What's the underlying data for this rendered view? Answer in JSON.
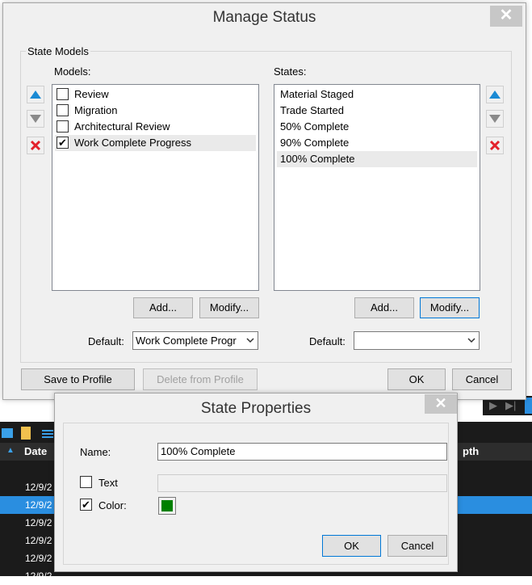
{
  "main_dialog": {
    "title": "Manage Status",
    "group_label": "State Models",
    "models_label": "Models:",
    "states_label": "States:",
    "models": [
      {
        "label": "Review",
        "checked": false
      },
      {
        "label": "Migration",
        "checked": false
      },
      {
        "label": "Architectural Review",
        "checked": false
      },
      {
        "label": "Work Complete Progress",
        "checked": true
      }
    ],
    "states": [
      "Material Staged",
      "Trade Started",
      "50% Complete",
      "90% Complete",
      "100% Complete"
    ],
    "add_label": "Add...",
    "modify_label": "Modify...",
    "default_label": "Default:",
    "models_default_value": "Work Complete Progr",
    "states_default_value": "",
    "save_profile_label": "Save to Profile",
    "delete_profile_label": "Delete from Profile",
    "ok_label": "OK",
    "cancel_label": "Cancel"
  },
  "state_dialog": {
    "title": "State Properties",
    "name_label": "Name:",
    "name_value": "100% Complete",
    "text_label": "Text",
    "text_checked": false,
    "text_value": "",
    "color_label": "Color:",
    "color_checked": true,
    "color_value": "#008000",
    "ok_label": "OK",
    "cancel_label": "Cancel"
  },
  "background_grid": {
    "header_date": "Date",
    "header_depth": "pth",
    "rows": [
      "12/9/2",
      "12/9/2",
      "12/9/2",
      "12/9/2",
      "12/9/2",
      "12/9/2"
    ]
  },
  "colors": {
    "selection_blue": "#2a8ee0",
    "up_arrow_blue": "#1a8ad4",
    "delete_red": "#e3212b"
  }
}
